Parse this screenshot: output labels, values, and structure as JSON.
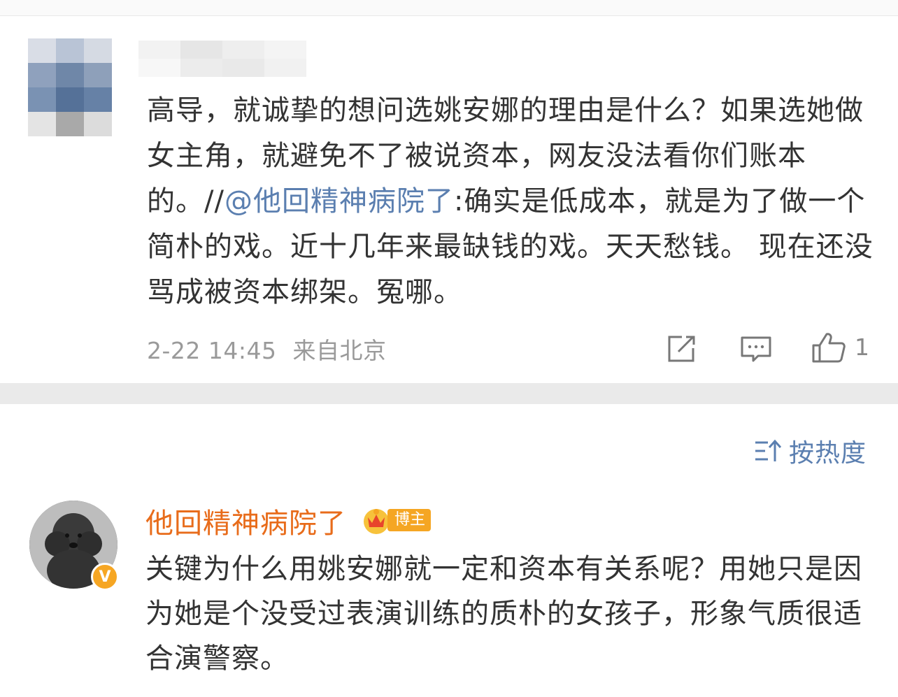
{
  "comment_top": {
    "body": "高导，就诚挚的想问选姚安娜的理由是什么？如果选她做女主角，就避免不了被说资本，网友没法看你们账本的。//",
    "mention": "@他回精神病院了",
    "repost_text": ":确实是低成本，就是为了做一个简朴的戏。近十几年来最缺钱的戏。天天愁钱。 现在还没骂成被资本绑架。冤哪。",
    "time": "2-22 14:45",
    "location": "来自北京",
    "like_count": "1",
    "icons": [
      "repost-icon",
      "comment-icon",
      "like-icon"
    ]
  },
  "sort": {
    "label": "按热度",
    "icon": "sort-icon"
  },
  "comment_blogger": {
    "username": "他回精神病院了",
    "badge_label": "博主",
    "verified_mark": "V",
    "body": "关键为什么用姚安娜就一定和资本有关系呢？用她只是因为她是个没受过表演训练的质朴的女孩子，形象气质很适合演警察。"
  },
  "colors": {
    "mention": "#5b7fb0",
    "username": "#e86c1b",
    "badge": "#f5a623",
    "meta": "#9a9a9a",
    "separator": "#eaeaea"
  }
}
